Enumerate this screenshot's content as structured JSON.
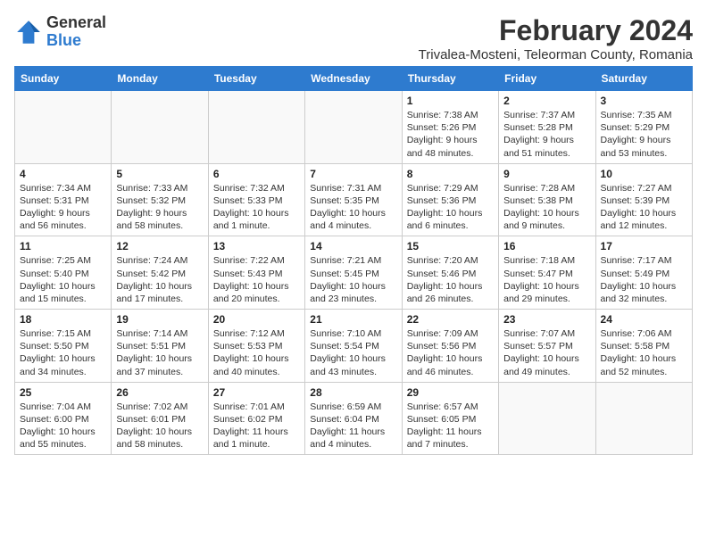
{
  "logo": {
    "text_general": "General",
    "text_blue": "Blue"
  },
  "title": "February 2024",
  "subtitle": "Trivalea-Mosteni, Teleorman County, Romania",
  "days_of_week": [
    "Sunday",
    "Monday",
    "Tuesday",
    "Wednesday",
    "Thursday",
    "Friday",
    "Saturday"
  ],
  "weeks": [
    [
      {
        "day": "",
        "info": ""
      },
      {
        "day": "",
        "info": ""
      },
      {
        "day": "",
        "info": ""
      },
      {
        "day": "",
        "info": ""
      },
      {
        "day": "1",
        "info": "Sunrise: 7:38 AM\nSunset: 5:26 PM\nDaylight: 9 hours\nand 48 minutes."
      },
      {
        "day": "2",
        "info": "Sunrise: 7:37 AM\nSunset: 5:28 PM\nDaylight: 9 hours\nand 51 minutes."
      },
      {
        "day": "3",
        "info": "Sunrise: 7:35 AM\nSunset: 5:29 PM\nDaylight: 9 hours\nand 53 minutes."
      }
    ],
    [
      {
        "day": "4",
        "info": "Sunrise: 7:34 AM\nSunset: 5:31 PM\nDaylight: 9 hours\nand 56 minutes."
      },
      {
        "day": "5",
        "info": "Sunrise: 7:33 AM\nSunset: 5:32 PM\nDaylight: 9 hours\nand 58 minutes."
      },
      {
        "day": "6",
        "info": "Sunrise: 7:32 AM\nSunset: 5:33 PM\nDaylight: 10 hours\nand 1 minute."
      },
      {
        "day": "7",
        "info": "Sunrise: 7:31 AM\nSunset: 5:35 PM\nDaylight: 10 hours\nand 4 minutes."
      },
      {
        "day": "8",
        "info": "Sunrise: 7:29 AM\nSunset: 5:36 PM\nDaylight: 10 hours\nand 6 minutes."
      },
      {
        "day": "9",
        "info": "Sunrise: 7:28 AM\nSunset: 5:38 PM\nDaylight: 10 hours\nand 9 minutes."
      },
      {
        "day": "10",
        "info": "Sunrise: 7:27 AM\nSunset: 5:39 PM\nDaylight: 10 hours\nand 12 minutes."
      }
    ],
    [
      {
        "day": "11",
        "info": "Sunrise: 7:25 AM\nSunset: 5:40 PM\nDaylight: 10 hours\nand 15 minutes."
      },
      {
        "day": "12",
        "info": "Sunrise: 7:24 AM\nSunset: 5:42 PM\nDaylight: 10 hours\nand 17 minutes."
      },
      {
        "day": "13",
        "info": "Sunrise: 7:22 AM\nSunset: 5:43 PM\nDaylight: 10 hours\nand 20 minutes."
      },
      {
        "day": "14",
        "info": "Sunrise: 7:21 AM\nSunset: 5:45 PM\nDaylight: 10 hours\nand 23 minutes."
      },
      {
        "day": "15",
        "info": "Sunrise: 7:20 AM\nSunset: 5:46 PM\nDaylight: 10 hours\nand 26 minutes."
      },
      {
        "day": "16",
        "info": "Sunrise: 7:18 AM\nSunset: 5:47 PM\nDaylight: 10 hours\nand 29 minutes."
      },
      {
        "day": "17",
        "info": "Sunrise: 7:17 AM\nSunset: 5:49 PM\nDaylight: 10 hours\nand 32 minutes."
      }
    ],
    [
      {
        "day": "18",
        "info": "Sunrise: 7:15 AM\nSunset: 5:50 PM\nDaylight: 10 hours\nand 34 minutes."
      },
      {
        "day": "19",
        "info": "Sunrise: 7:14 AM\nSunset: 5:51 PM\nDaylight: 10 hours\nand 37 minutes."
      },
      {
        "day": "20",
        "info": "Sunrise: 7:12 AM\nSunset: 5:53 PM\nDaylight: 10 hours\nand 40 minutes."
      },
      {
        "day": "21",
        "info": "Sunrise: 7:10 AM\nSunset: 5:54 PM\nDaylight: 10 hours\nand 43 minutes."
      },
      {
        "day": "22",
        "info": "Sunrise: 7:09 AM\nSunset: 5:56 PM\nDaylight: 10 hours\nand 46 minutes."
      },
      {
        "day": "23",
        "info": "Sunrise: 7:07 AM\nSunset: 5:57 PM\nDaylight: 10 hours\nand 49 minutes."
      },
      {
        "day": "24",
        "info": "Sunrise: 7:06 AM\nSunset: 5:58 PM\nDaylight: 10 hours\nand 52 minutes."
      }
    ],
    [
      {
        "day": "25",
        "info": "Sunrise: 7:04 AM\nSunset: 6:00 PM\nDaylight: 10 hours\nand 55 minutes."
      },
      {
        "day": "26",
        "info": "Sunrise: 7:02 AM\nSunset: 6:01 PM\nDaylight: 10 hours\nand 58 minutes."
      },
      {
        "day": "27",
        "info": "Sunrise: 7:01 AM\nSunset: 6:02 PM\nDaylight: 11 hours\nand 1 minute."
      },
      {
        "day": "28",
        "info": "Sunrise: 6:59 AM\nSunset: 6:04 PM\nDaylight: 11 hours\nand 4 minutes."
      },
      {
        "day": "29",
        "info": "Sunrise: 6:57 AM\nSunset: 6:05 PM\nDaylight: 11 hours\nand 7 minutes."
      },
      {
        "day": "",
        "info": ""
      },
      {
        "day": "",
        "info": ""
      }
    ]
  ]
}
